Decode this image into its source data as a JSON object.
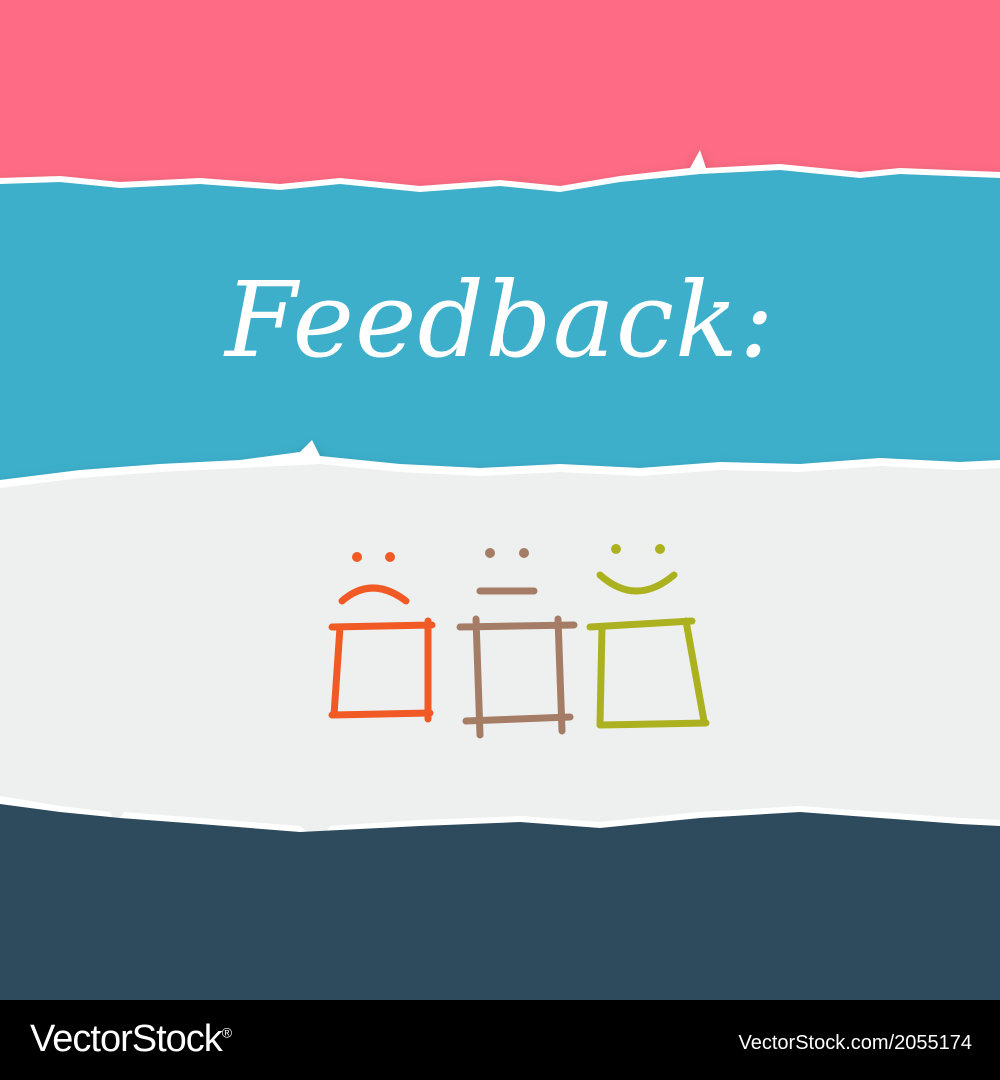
{
  "title": "Feedback:",
  "colors": {
    "pink": "#fd6b84",
    "blue": "#3eafcb",
    "paper": "#eef0f0",
    "navy": "#2e4a5d",
    "sad": "#f15a24",
    "neutral": "#a57c65",
    "happy": "#acb11f"
  },
  "faces": [
    {
      "name": "sad-face-checkbox"
    },
    {
      "name": "neutral-face-checkbox"
    },
    {
      "name": "happy-face-checkbox"
    }
  ],
  "footer": {
    "brand": "VectorStock",
    "trademark": "®",
    "ref": "VectorStock.com/2055174"
  }
}
